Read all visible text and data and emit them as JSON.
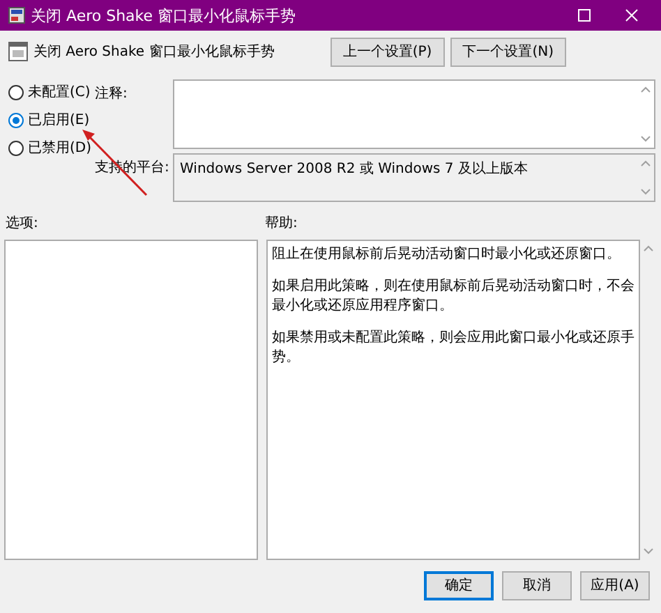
{
  "window": {
    "title": "关闭 Aero Shake 窗口最小化鼠标手势"
  },
  "policy": {
    "name": "关闭 Aero Shake 窗口最小化鼠标手势"
  },
  "nav_buttons": [
    "上一个设置(P)",
    "下一个设置(N)"
  ],
  "state_options": [
    {
      "label": "未配置(C)",
      "selected": false
    },
    {
      "label": "已启用(E)",
      "selected": true
    },
    {
      "label": "已禁用(D)",
      "selected": false
    }
  ],
  "comment": {
    "label": "注释:"
  },
  "supported_on": {
    "label": "支持的平台:",
    "value": "Windows Server 2008 R2 或 Windows 7 及以上版本"
  },
  "options": {
    "label": "选项:"
  },
  "help": {
    "label": "帮助:",
    "paragraphs": [
      "阻止在使用鼠标前后晃动活动窗口时最小化或还原窗口。",
      "如果启用此策略，则在使用鼠标前后晃动活动窗口时，不会最小化或还原应用程序窗口。",
      "如果禁用或未配置此策略，则会应用此窗口最小化或还原手势。"
    ]
  },
  "buttons": [
    {
      "label": "确定",
      "default": true
    },
    {
      "label": "取消",
      "default": false
    },
    {
      "label": "应用(A)",
      "default": false
    }
  ]
}
